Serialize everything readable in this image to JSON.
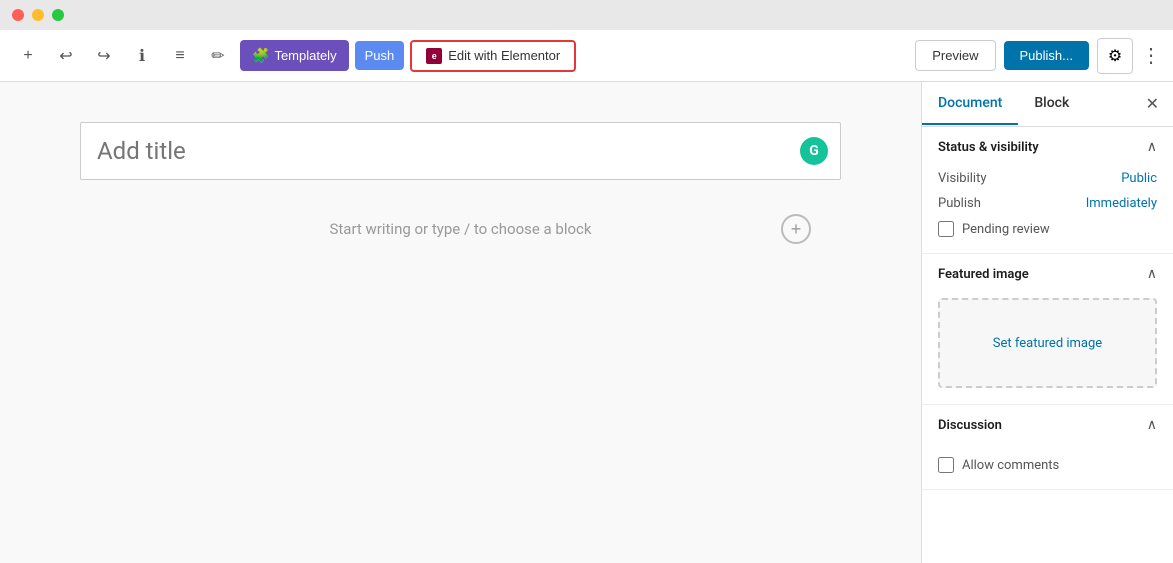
{
  "titleBar": {
    "trafficLights": [
      "red",
      "yellow",
      "green"
    ]
  },
  "toolbar": {
    "addIcon": "+",
    "undoIcon": "↩",
    "redoIcon": "↪",
    "infoIcon": "ℹ",
    "listIcon": "≡",
    "editIcon": "✏",
    "templatelyLabel": "Templately",
    "pushLabel": "Push",
    "elementorLabel": "Edit with Elementor",
    "previewLabel": "Preview",
    "publishLabel": "Publish...",
    "settingsIcon": "⚙",
    "moreIcon": "⋮"
  },
  "editor": {
    "titlePlaceholder": "Add title",
    "contentPlaceholder": "Start writing or type / to choose a block",
    "addBlockIcon": "+"
  },
  "sidebar": {
    "tabs": [
      {
        "label": "Document",
        "active": true
      },
      {
        "label": "Block",
        "active": false
      }
    ],
    "closeIcon": "✕",
    "sections": [
      {
        "title": "Status & visibility",
        "rows": [
          {
            "label": "Visibility",
            "value": "Public"
          },
          {
            "label": "Publish",
            "value": "Immediately"
          }
        ],
        "checkbox": {
          "label": "Pending review",
          "checked": false
        }
      },
      {
        "title": "Featured image",
        "placeholder": "Set featured image"
      },
      {
        "title": "Discussion",
        "checkbox": {
          "label": "Allow comments",
          "checked": false
        }
      }
    ]
  }
}
